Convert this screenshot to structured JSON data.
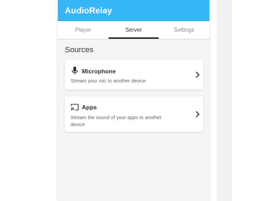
{
  "app": {
    "title": "AudioRelay"
  },
  "tabs": [
    {
      "label": "Player",
      "active": false
    },
    {
      "label": "Server",
      "active": true
    },
    {
      "label": "Settings",
      "active": false
    }
  ],
  "colors": {
    "accent": "#37b6f6",
    "background": "#f5f5f5",
    "card": "#ffffff"
  },
  "sources": {
    "title": "Sources",
    "items": [
      {
        "icon": "microphone-icon",
        "title": "Microphone",
        "description": "Stream your mic to another device"
      },
      {
        "icon": "cast-icon",
        "title": "Apps",
        "description": "Stream the sound of your apps to another device"
      }
    ]
  }
}
